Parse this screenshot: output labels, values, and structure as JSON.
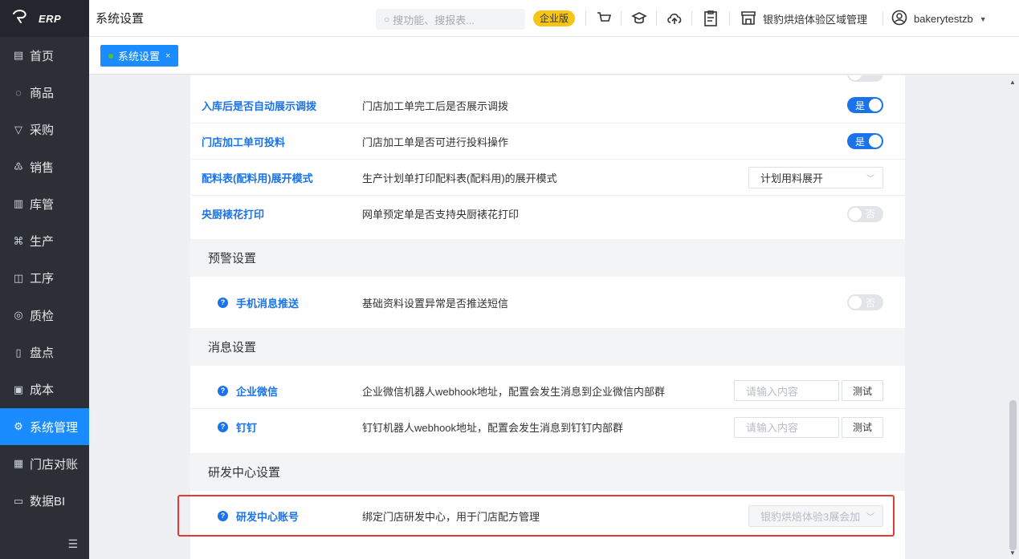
{
  "app": {
    "logo_text": "ERP",
    "page_title": "系统设置"
  },
  "header": {
    "search_placeholder": "搜功能、搜报表...",
    "edition_badge": "企业版",
    "store_name": "银豹烘焙体验区域管理",
    "username": "bakerytestzb"
  },
  "sidebar": {
    "items": [
      {
        "label": "首页",
        "icon": "home-icon",
        "glyph": "▤"
      },
      {
        "label": "商品",
        "icon": "goods-icon",
        "glyph": "◌"
      },
      {
        "label": "采购",
        "icon": "purchase-icon",
        "glyph": "▽"
      },
      {
        "label": "销售",
        "icon": "sales-icon",
        "glyph": "♳"
      },
      {
        "label": "库管",
        "icon": "inventory-icon",
        "glyph": "▥"
      },
      {
        "label": "生产",
        "icon": "production-icon",
        "glyph": "⌘"
      },
      {
        "label": "工序",
        "icon": "process-icon",
        "glyph": "◫"
      },
      {
        "label": "质检",
        "icon": "quality-icon",
        "glyph": "◎"
      },
      {
        "label": "盘点",
        "icon": "stocktake-icon",
        "glyph": "▯"
      },
      {
        "label": "成本",
        "icon": "cost-icon",
        "glyph": "▣"
      },
      {
        "label": "系统管理",
        "icon": "system-icon",
        "glyph": "⚙",
        "active": true
      },
      {
        "label": "门店对账",
        "icon": "reconcile-icon",
        "glyph": "▦"
      },
      {
        "label": "数据BI",
        "icon": "bi-icon",
        "glyph": "▭"
      }
    ]
  },
  "tabs": [
    {
      "label": "系统设置",
      "close": "×"
    }
  ],
  "settings": {
    "rows_top": [
      {
        "label": "入库后是否自动展示调拨",
        "desc": "门店加工单完工后是否展示调拨",
        "control": "switch",
        "value": "是"
      },
      {
        "label": "门店加工单可投料",
        "desc": "门店加工单是否可进行投料操作",
        "control": "switch",
        "value": "是"
      },
      {
        "label": "配料表(配料用)展开模式",
        "desc": "生产计划单打印配料表(配料用)的展开模式",
        "control": "select",
        "value": "计划用料展开"
      },
      {
        "label": "央厨裱花打印",
        "desc": "网单预定单是否支持央厨裱花打印",
        "control": "switch-off",
        "value": "否"
      }
    ],
    "sections": {
      "alert": "预警设置",
      "message": "消息设置",
      "rd": "研发中心设置"
    },
    "alert_row": {
      "label": "手机消息推送",
      "desc": "基础资料设置异常是否推送短信",
      "value": "否"
    },
    "message_rows": [
      {
        "label": "企业微信",
        "desc": "企业微信机器人webhook地址，配置会发生消息到企业微信内部群",
        "placeholder": "请输入内容",
        "button": "测试"
      },
      {
        "label": "钉钉",
        "desc": "钉钉机器人webhook地址，配置会发生消息到钉钉内部群",
        "placeholder": "请输入内容",
        "button": "测试"
      }
    ],
    "rd_row": {
      "label": "研发中心账号",
      "desc": "绑定门店研发中心，用于门店配方管理",
      "value": "银豹烘焙体验3展会加"
    }
  },
  "colors": {
    "sidebar_bg": "#2c2f36",
    "accent": "#1a8cff",
    "link": "#1a73e8",
    "highlight_border": "#e53935",
    "badge": "#f5c518"
  }
}
